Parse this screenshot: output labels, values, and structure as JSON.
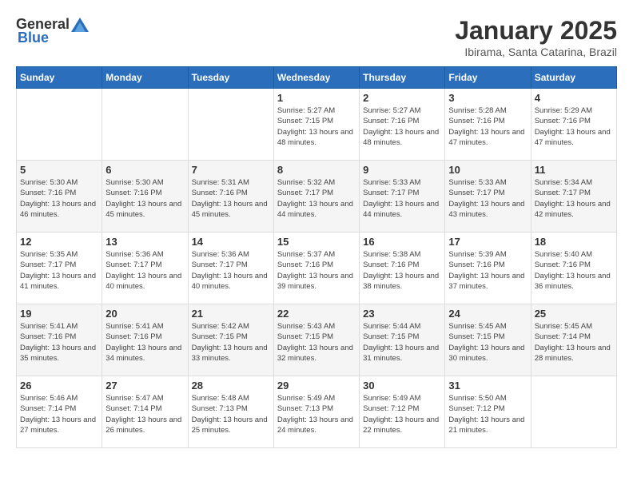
{
  "header": {
    "logo_general": "General",
    "logo_blue": "Blue",
    "month": "January 2025",
    "location": "Ibirama, Santa Catarina, Brazil"
  },
  "days_of_week": [
    "Sunday",
    "Monday",
    "Tuesday",
    "Wednesday",
    "Thursday",
    "Friday",
    "Saturday"
  ],
  "weeks": [
    [
      {
        "day": "",
        "sunrise": "",
        "sunset": "",
        "daylight": ""
      },
      {
        "day": "",
        "sunrise": "",
        "sunset": "",
        "daylight": ""
      },
      {
        "day": "",
        "sunrise": "",
        "sunset": "",
        "daylight": ""
      },
      {
        "day": "1",
        "sunrise": "Sunrise: 5:27 AM",
        "sunset": "Sunset: 7:15 PM",
        "daylight": "Daylight: 13 hours and 48 minutes."
      },
      {
        "day": "2",
        "sunrise": "Sunrise: 5:27 AM",
        "sunset": "Sunset: 7:16 PM",
        "daylight": "Daylight: 13 hours and 48 minutes."
      },
      {
        "day": "3",
        "sunrise": "Sunrise: 5:28 AM",
        "sunset": "Sunset: 7:16 PM",
        "daylight": "Daylight: 13 hours and 47 minutes."
      },
      {
        "day": "4",
        "sunrise": "Sunrise: 5:29 AM",
        "sunset": "Sunset: 7:16 PM",
        "daylight": "Daylight: 13 hours and 47 minutes."
      }
    ],
    [
      {
        "day": "5",
        "sunrise": "Sunrise: 5:30 AM",
        "sunset": "Sunset: 7:16 PM",
        "daylight": "Daylight: 13 hours and 46 minutes."
      },
      {
        "day": "6",
        "sunrise": "Sunrise: 5:30 AM",
        "sunset": "Sunset: 7:16 PM",
        "daylight": "Daylight: 13 hours and 45 minutes."
      },
      {
        "day": "7",
        "sunrise": "Sunrise: 5:31 AM",
        "sunset": "Sunset: 7:16 PM",
        "daylight": "Daylight: 13 hours and 45 minutes."
      },
      {
        "day": "8",
        "sunrise": "Sunrise: 5:32 AM",
        "sunset": "Sunset: 7:17 PM",
        "daylight": "Daylight: 13 hours and 44 minutes."
      },
      {
        "day": "9",
        "sunrise": "Sunrise: 5:33 AM",
        "sunset": "Sunset: 7:17 PM",
        "daylight": "Daylight: 13 hours and 44 minutes."
      },
      {
        "day": "10",
        "sunrise": "Sunrise: 5:33 AM",
        "sunset": "Sunset: 7:17 PM",
        "daylight": "Daylight: 13 hours and 43 minutes."
      },
      {
        "day": "11",
        "sunrise": "Sunrise: 5:34 AM",
        "sunset": "Sunset: 7:17 PM",
        "daylight": "Daylight: 13 hours and 42 minutes."
      }
    ],
    [
      {
        "day": "12",
        "sunrise": "Sunrise: 5:35 AM",
        "sunset": "Sunset: 7:17 PM",
        "daylight": "Daylight: 13 hours and 41 minutes."
      },
      {
        "day": "13",
        "sunrise": "Sunrise: 5:36 AM",
        "sunset": "Sunset: 7:17 PM",
        "daylight": "Daylight: 13 hours and 40 minutes."
      },
      {
        "day": "14",
        "sunrise": "Sunrise: 5:36 AM",
        "sunset": "Sunset: 7:17 PM",
        "daylight": "Daylight: 13 hours and 40 minutes."
      },
      {
        "day": "15",
        "sunrise": "Sunrise: 5:37 AM",
        "sunset": "Sunset: 7:16 PM",
        "daylight": "Daylight: 13 hours and 39 minutes."
      },
      {
        "day": "16",
        "sunrise": "Sunrise: 5:38 AM",
        "sunset": "Sunset: 7:16 PM",
        "daylight": "Daylight: 13 hours and 38 minutes."
      },
      {
        "day": "17",
        "sunrise": "Sunrise: 5:39 AM",
        "sunset": "Sunset: 7:16 PM",
        "daylight": "Daylight: 13 hours and 37 minutes."
      },
      {
        "day": "18",
        "sunrise": "Sunrise: 5:40 AM",
        "sunset": "Sunset: 7:16 PM",
        "daylight": "Daylight: 13 hours and 36 minutes."
      }
    ],
    [
      {
        "day": "19",
        "sunrise": "Sunrise: 5:41 AM",
        "sunset": "Sunset: 7:16 PM",
        "daylight": "Daylight: 13 hours and 35 minutes."
      },
      {
        "day": "20",
        "sunrise": "Sunrise: 5:41 AM",
        "sunset": "Sunset: 7:16 PM",
        "daylight": "Daylight: 13 hours and 34 minutes."
      },
      {
        "day": "21",
        "sunrise": "Sunrise: 5:42 AM",
        "sunset": "Sunset: 7:15 PM",
        "daylight": "Daylight: 13 hours and 33 minutes."
      },
      {
        "day": "22",
        "sunrise": "Sunrise: 5:43 AM",
        "sunset": "Sunset: 7:15 PM",
        "daylight": "Daylight: 13 hours and 32 minutes."
      },
      {
        "day": "23",
        "sunrise": "Sunrise: 5:44 AM",
        "sunset": "Sunset: 7:15 PM",
        "daylight": "Daylight: 13 hours and 31 minutes."
      },
      {
        "day": "24",
        "sunrise": "Sunrise: 5:45 AM",
        "sunset": "Sunset: 7:15 PM",
        "daylight": "Daylight: 13 hours and 30 minutes."
      },
      {
        "day": "25",
        "sunrise": "Sunrise: 5:45 AM",
        "sunset": "Sunset: 7:14 PM",
        "daylight": "Daylight: 13 hours and 28 minutes."
      }
    ],
    [
      {
        "day": "26",
        "sunrise": "Sunrise: 5:46 AM",
        "sunset": "Sunset: 7:14 PM",
        "daylight": "Daylight: 13 hours and 27 minutes."
      },
      {
        "day": "27",
        "sunrise": "Sunrise: 5:47 AM",
        "sunset": "Sunset: 7:14 PM",
        "daylight": "Daylight: 13 hours and 26 minutes."
      },
      {
        "day": "28",
        "sunrise": "Sunrise: 5:48 AM",
        "sunset": "Sunset: 7:13 PM",
        "daylight": "Daylight: 13 hours and 25 minutes."
      },
      {
        "day": "29",
        "sunrise": "Sunrise: 5:49 AM",
        "sunset": "Sunset: 7:13 PM",
        "daylight": "Daylight: 13 hours and 24 minutes."
      },
      {
        "day": "30",
        "sunrise": "Sunrise: 5:49 AM",
        "sunset": "Sunset: 7:12 PM",
        "daylight": "Daylight: 13 hours and 22 minutes."
      },
      {
        "day": "31",
        "sunrise": "Sunrise: 5:50 AM",
        "sunset": "Sunset: 7:12 PM",
        "daylight": "Daylight: 13 hours and 21 minutes."
      },
      {
        "day": "",
        "sunrise": "",
        "sunset": "",
        "daylight": ""
      }
    ]
  ]
}
